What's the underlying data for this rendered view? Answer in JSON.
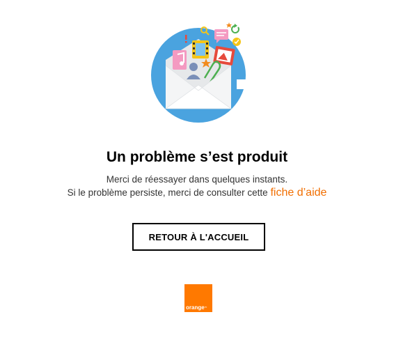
{
  "error": {
    "title": "Un problème s’est produit",
    "line1": "Merci de réessayer dans quelques instants.",
    "line2_prefix": "Si le problème persiste, merci de consulter cette",
    "help_link": "fiche d’aide"
  },
  "actions": {
    "home_button": "RETOUR À L'ACCUEIL"
  },
  "brand": {
    "logo_text": "orange",
    "logo_tm": "™",
    "color": "#ff7900"
  },
  "colors": {
    "accent_link": "#f16e00",
    "illustration_blue": "#4aa3df"
  },
  "icons": [
    "envelope-icon",
    "music-note-icon",
    "film-icon",
    "photo-icon",
    "user-icon",
    "paperclip-icon",
    "search-icon",
    "chat-bubble-icon",
    "refresh-icon",
    "check-icon",
    "star-icon",
    "exclamation-icon"
  ]
}
